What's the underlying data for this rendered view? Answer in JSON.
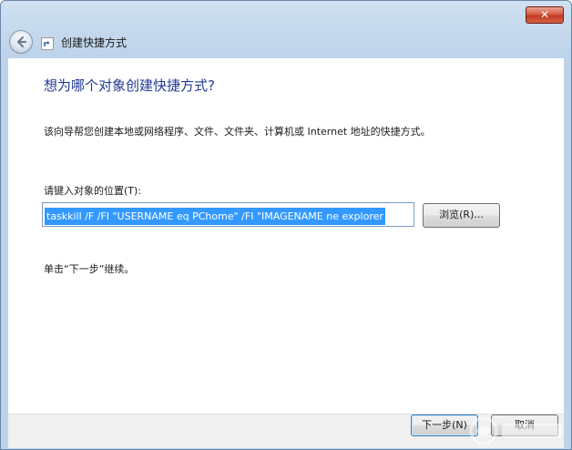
{
  "window": {
    "title": "创建快捷方式",
    "close_label": "✕"
  },
  "content": {
    "heading": "想为哪个对象创建快捷方式?",
    "description": "该向导帮您创建本地或网络程序、文件、文件夹、计算机或 Internet 地址的快捷方式。",
    "location_label": "请键入对象的位置(T):",
    "location_value": "taskkill /F /FI \"USERNAME eq PChome\" /FI \"IMAGENAME ne explorer",
    "browse_label": "浏览(R)...",
    "hint": "单击“下一步”继续。"
  },
  "footer": {
    "next_label": "下一步(N)",
    "cancel_label": "取消"
  },
  "colors": {
    "heading": "#1f3a93",
    "selection": "#3399ff",
    "close": "#c0381f"
  }
}
